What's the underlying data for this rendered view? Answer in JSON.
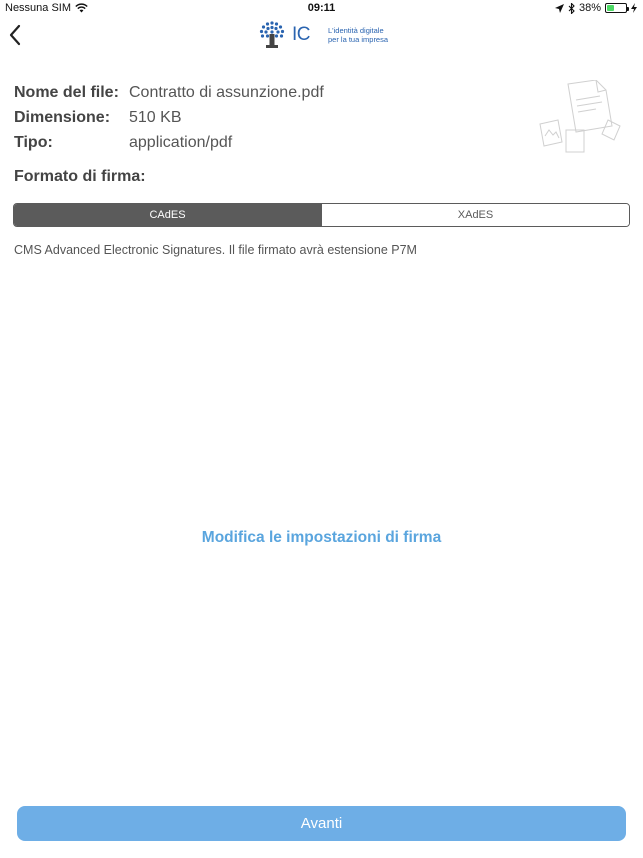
{
  "status_bar": {
    "carrier": "Nessuna SIM",
    "time": "09:11",
    "battery_percent": "38%",
    "battery_level": 0.38,
    "icons": [
      "wifi-icon",
      "location-arrow-icon",
      "bluetooth-icon",
      "battery-icon",
      "charging-bolt-icon"
    ]
  },
  "nav": {
    "back_icon": "chevron-left-icon",
    "logo_mark": "IC",
    "logo_tagline_line1": "L'identità digitale",
    "logo_tagline_line2": "per la tua impresa"
  },
  "file_info": {
    "name_label": "Nome del file:",
    "name_value": "Contratto di assunzione.pdf",
    "size_label": "Dimensione:",
    "size_value": "510 KB",
    "type_label": "Tipo:",
    "type_value": "application/pdf"
  },
  "signature_format": {
    "title": "Formato di firma:",
    "options": [
      "CAdES",
      "XAdES"
    ],
    "selected": "CAdES",
    "description": "CMS Advanced Electronic Signatures. Il file firmato avrà estensione P7M"
  },
  "settings_link": "Modifica le impostazioni di firma",
  "next_button": "Avanti",
  "colors": {
    "accent": "#5aa5de",
    "button": "#6eaee6",
    "segment_dark": "#5b5b5b",
    "logo_blue": "#2a64b0"
  }
}
